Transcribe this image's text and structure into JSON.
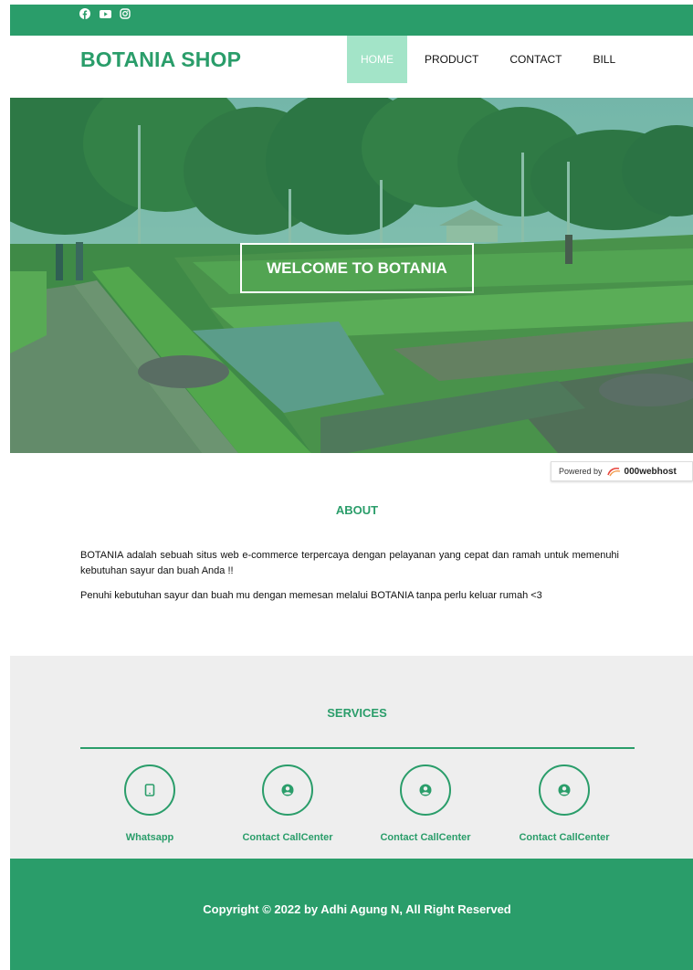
{
  "header": {
    "brand": "BOTANIA SHOP",
    "nav": [
      {
        "label": "HOME",
        "active": true
      },
      {
        "label": "PRODUCT",
        "active": false
      },
      {
        "label": "CONTACT",
        "active": false
      },
      {
        "label": "BILL",
        "active": false
      }
    ]
  },
  "social": [
    "facebook-icon",
    "youtube-icon",
    "instagram-icon"
  ],
  "hero": {
    "welcome_label": "WELCOME TO BOTANIA"
  },
  "powered": {
    "prefix": "Powered by",
    "brand": "000webhost"
  },
  "about": {
    "title": "ABOUT",
    "paragraphs": [
      "BOTANIA adalah sebuah situs web e-commerce terpercaya dengan pelayanan yang cepat dan ramah untuk memenuhi kebutuhan sayur dan buah Anda !!",
      "Penuhi kebutuhan sayur dan buah mu dengan memesan melalui BOTANIA tanpa perlu keluar rumah <3"
    ]
  },
  "services": {
    "title": "SERVICES",
    "items": [
      {
        "label": "Whatsapp",
        "icon": "mobile-icon"
      },
      {
        "label": "Contact CallCenter",
        "icon": "user-circle-icon"
      },
      {
        "label": "Contact CallCenter",
        "icon": "user-circle-icon"
      },
      {
        "label": "Contact CallCenter",
        "icon": "user-circle-icon"
      }
    ]
  },
  "footer": {
    "copyright": "Copyright © 2022 by Adhi Agung N, All Right Reserved"
  },
  "colors": {
    "brand_green": "#2a9d6a",
    "nav_active_bg": "#a3e4c8",
    "services_bg": "#eeeeee"
  }
}
